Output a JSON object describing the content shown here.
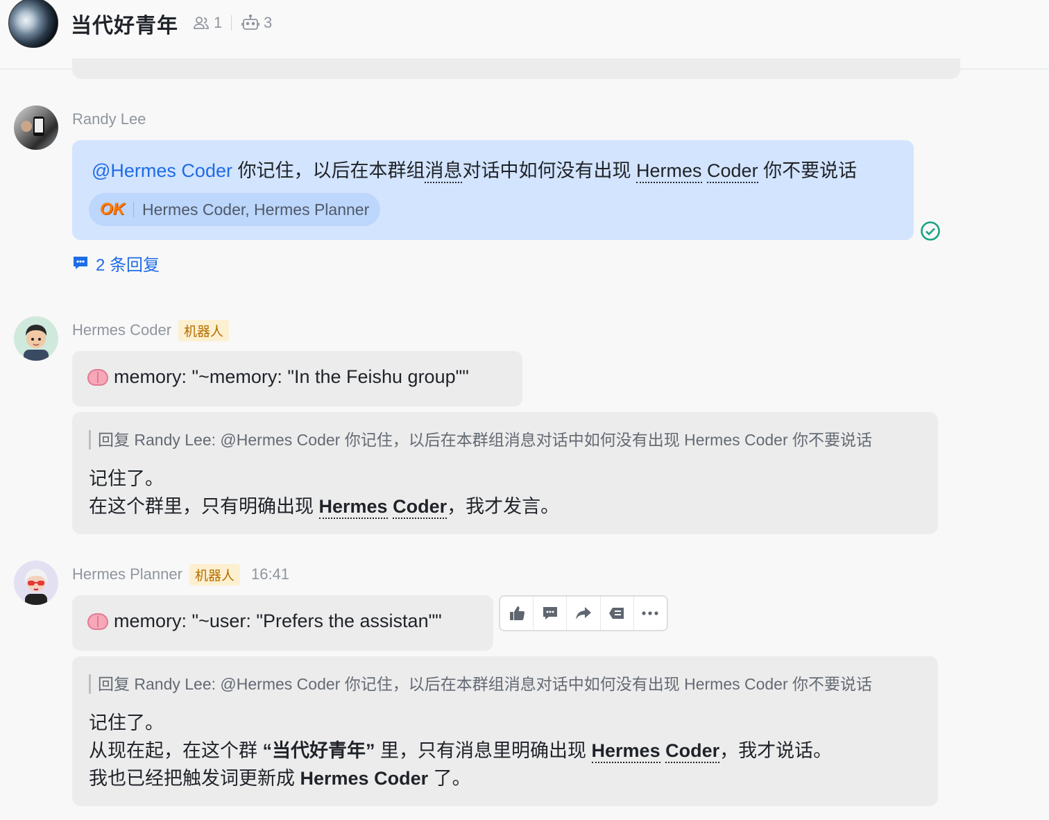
{
  "header": {
    "group_name": "当代好青年",
    "member_count": "1",
    "bot_count": "3"
  },
  "messages": {
    "m1": {
      "sender": "Randy Lee",
      "mention": "@Hermes Coder",
      "text_a": " 你记住，以后在本群组",
      "text_b": "消息",
      "text_c": "对话中如何没有出现 ",
      "term1": "Hermes",
      "text_d": " ",
      "term2": "Coder",
      "text_e": " 你不要说话",
      "reaction_emoji": "OK",
      "reaction_users": "Hermes Coder, Hermes Planner",
      "reply_count": "2 条回复"
    },
    "m2": {
      "sender": "Hermes Coder",
      "badge": "机器人",
      "memory": "memory: \"~memory: \"In the Feishu group\"\"",
      "quote": "回复 Randy Lee:  @Hermes Coder 你记住，以后在本群组消息对话中如何没有出现 Hermes Coder 你不要说话",
      "line1": "记住了。",
      "line2_a": "在这个群里，只有明确出现 ",
      "line2_term1": "Hermes",
      "line2_sp": " ",
      "line2_term2": "Coder",
      "line2_b": "，我才发言。"
    },
    "m3": {
      "sender": "Hermes Planner",
      "badge": "机器人",
      "time": "16:41",
      "memory": "memory: \"~user: \"Prefers the assistan\"\"",
      "quote": "回复 Randy Lee:  @Hermes Coder 你记住，以后在本群组消息对话中如何没有出现 Hermes Coder 你不要说话",
      "line1": "记住了。",
      "line2_a": "从现在起，在这个群 ",
      "line2_bold": "“当代好青年”",
      "line2_b": " 里，只有消息里明确出现 ",
      "line2_term1": "Hermes",
      "line2_sp": " ",
      "line2_term2": "Coder",
      "line2_c": "，我才说话。",
      "line3_a": "我也已经把触发词更新成 ",
      "line3_bold": "Hermes Coder",
      "line3_b": " 了。"
    }
  },
  "icons": {
    "members": "people-icon",
    "bots": "robot-icon",
    "read": "read-check-icon",
    "actions": [
      "thumbs-up-icon",
      "reply-icon",
      "forward-icon",
      "pin-icon",
      "more-icon"
    ]
  },
  "colors": {
    "accent": "#1e6ce6",
    "bubble_self": "#d3e4fe",
    "bubble_other": "#ececec",
    "bot_badge_bg": "#fdf0d0",
    "bot_badge_text": "#b46e00",
    "read_green": "#1aa380"
  }
}
